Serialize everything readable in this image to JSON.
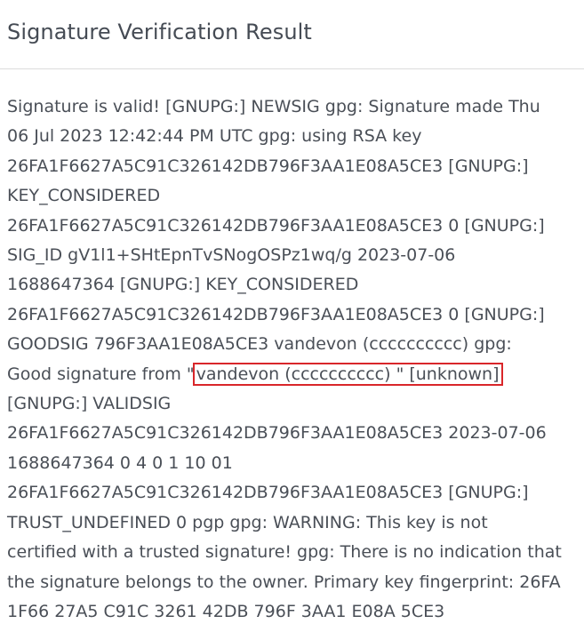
{
  "panel": {
    "title": "Signature Verification Result"
  },
  "result": {
    "lines": [
      "Signature is valid! [GNUPG:] NEWSIG gpg: Signature made Thu",
      "06 Jul 2023 12:42:44 PM UTC gpg: using RSA key",
      "26FA1F6627A5C91C326142DB796F3AA1E08A5CE3 [GNUPG:]",
      "KEY_CONSIDERED",
      "26FA1F6627A5C91C326142DB796F3AA1E08A5CE3 0 [GNUPG:]",
      "SIG_ID gV1l1+SHtEpnTvSNogOSPz1wq/g 2023-07-06",
      "1688647364 [GNUPG:] KEY_CONSIDERED",
      "26FA1F6627A5C91C326142DB796F3AA1E08A5CE3 0 [GNUPG:]",
      "GOODSIG 796F3AA1E08A5CE3 vandevon (cccccccccc) gpg:"
    ],
    "good_sig_prefix": "Good signature from \"",
    "good_sig_highlight": "vandevon (cccccccccc) \" [unknown]",
    "lines_after": [
      "[GNUPG:] VALIDSIG",
      "26FA1F6627A5C91C326142DB796F3AA1E08A5CE3 2023-07-06",
      "1688647364 0 4 0 1 10 01",
      "26FA1F6627A5C91C326142DB796F3AA1E08A5CE3 [GNUPG:]",
      "TRUST_UNDEFINED 0 pgp gpg: WARNING: This key is not",
      "certified with a trusted signature! gpg: There is no indication that",
      "the signature belongs to the owner. Primary key fingerprint: 26FA",
      "1F66 27A5 C91C 3261 42DB 796F 3AA1 E08A 5CE3"
    ]
  },
  "colors": {
    "highlight_border": "#d9262a",
    "text": "#4a4f57",
    "divider": "#dcdcdc"
  }
}
